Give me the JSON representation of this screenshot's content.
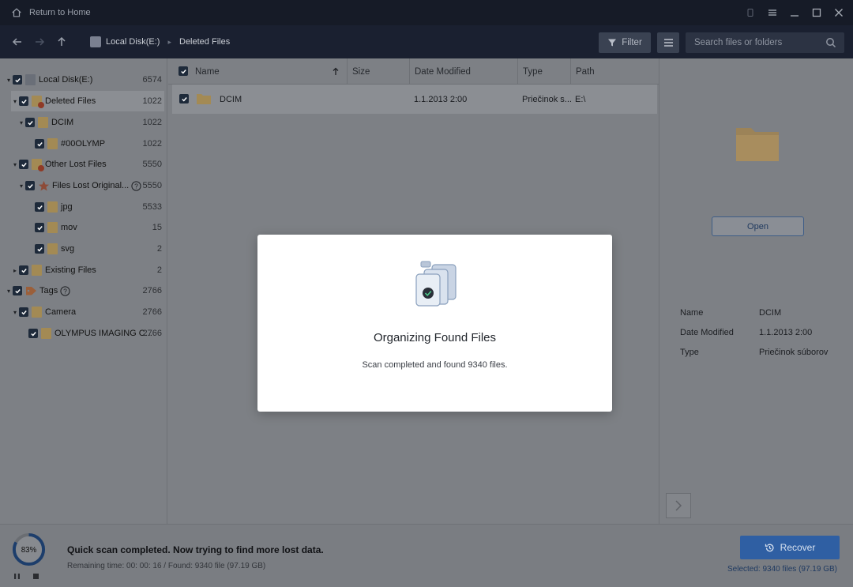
{
  "titlebar": {
    "home_label": "Return to Home"
  },
  "nav": {
    "breadcrumb_root": "Local Disk(E:)",
    "breadcrumb_current": "Deleted Files",
    "filter_label": "Filter",
    "search_placeholder": "Search files or folders"
  },
  "tree": [
    {
      "label": "Local Disk(E:)",
      "count": "6574"
    },
    {
      "label": "Deleted Files",
      "count": "1022"
    },
    {
      "label": "DCIM",
      "count": "1022"
    },
    {
      "label": "#00OLYMP",
      "count": "1022"
    },
    {
      "label": "Other Lost Files",
      "count": "5550"
    },
    {
      "label": "Files Lost Original...",
      "count": "5550"
    },
    {
      "label": "jpg",
      "count": "5533"
    },
    {
      "label": "mov",
      "count": "15"
    },
    {
      "label": "svg",
      "count": "2"
    },
    {
      "label": "Existing Files",
      "count": "2"
    },
    {
      "label": "Tags",
      "count": "2766"
    },
    {
      "label": "Camera",
      "count": "2766"
    },
    {
      "label": "OLYMPUS IMAGING C...",
      "count": "2766"
    }
  ],
  "columns": {
    "name": "Name",
    "size": "Size",
    "date": "Date Modified",
    "type": "Type",
    "path": "Path"
  },
  "files": [
    {
      "name": "DCIM",
      "size": "",
      "date": "1.1.2013 2:00",
      "type": "Priečinok s...",
      "path": "E:\\"
    }
  ],
  "preview": {
    "open_label": "Open",
    "name_label": "Name",
    "name_value": "DCIM",
    "date_label": "Date Modified",
    "date_value": "1.1.2013 2:00",
    "type_label": "Type",
    "type_value": "Priečinok súborov"
  },
  "bottom": {
    "progress": "83%",
    "progress_fraction": 0.83,
    "status_main": "Quick scan completed. Now trying to find more lost data.",
    "status_sub": "Remaining time: 00: 00: 16 / Found: 9340 file (97.19 GB)",
    "recover_label": "Recover",
    "selected_info": "Selected: 9340 files (97.19 GB)"
  },
  "modal": {
    "title": "Organizing Found Files",
    "message": "Scan completed and found 9340 files."
  },
  "colors": {
    "accent": "#2f5fa3",
    "titlebar": "#161b27",
    "folder": "#e8b26a"
  }
}
